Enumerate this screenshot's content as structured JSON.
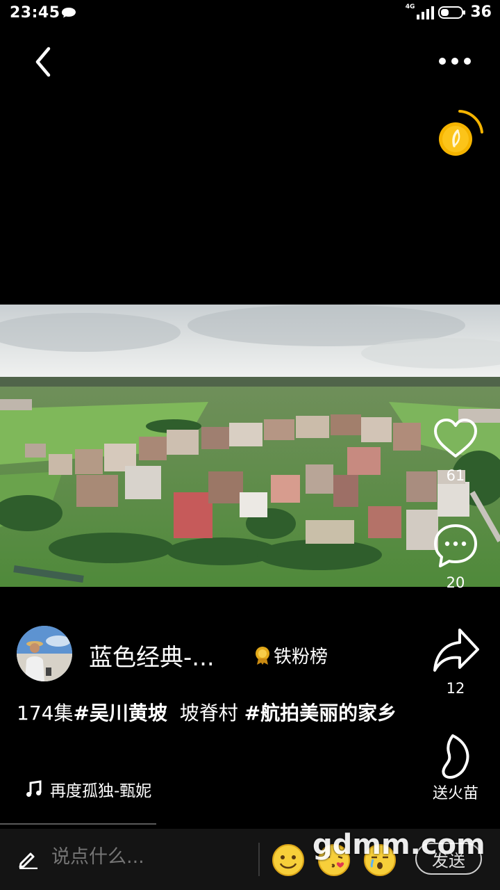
{
  "status_bar": {
    "time": "23:45",
    "network": "4G",
    "battery": "36",
    "icons": [
      "message-icon",
      "signal-icon",
      "battery-icon"
    ]
  },
  "top_bar": {
    "back_icon": "chevron-left-icon",
    "more_icon": "more-dots-icon",
    "reward_icon": "gold-coin-icon"
  },
  "video": {
    "description_icon": "aerial-village-video"
  },
  "actions": {
    "like_count": "61",
    "comment_count": "20",
    "share_count": "12",
    "fire_label": "送火苗"
  },
  "author": {
    "name": "蓝色经典-...",
    "badge": "铁粉榜"
  },
  "caption": {
    "parts": [
      {
        "text": "174集",
        "bold": false
      },
      {
        "text": "#吴川黄坡",
        "bold": true
      },
      {
        "text": "  坡脊村 ",
        "bold": false
      },
      {
        "text": "#航拍美丽的家乡",
        "bold": true
      }
    ]
  },
  "music": {
    "title": "再度孤独-甄妮"
  },
  "bottom_bar": {
    "input_placeholder": "说点什么...",
    "send_label": "发送",
    "watermark": "gdmm.com"
  },
  "colors": {
    "background": "#000000",
    "bottom_bar": "#141414",
    "coin": "#f5b400"
  }
}
